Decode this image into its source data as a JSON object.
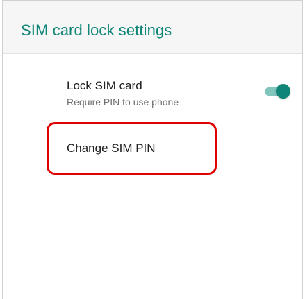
{
  "header": {
    "title": "SIM card lock settings"
  },
  "preferences": [
    {
      "title": "Lock SIM card",
      "summary": "Require PIN to use phone",
      "switch_on": true
    },
    {
      "title": "Change SIM PIN"
    }
  ],
  "colors": {
    "accent": "#0e8576",
    "switch_track": "#80c6bd",
    "highlight": "#e00000",
    "appbar_bg": "#f6f6f6"
  },
  "icons": {
    "lock_switch": "toggle-switch"
  }
}
